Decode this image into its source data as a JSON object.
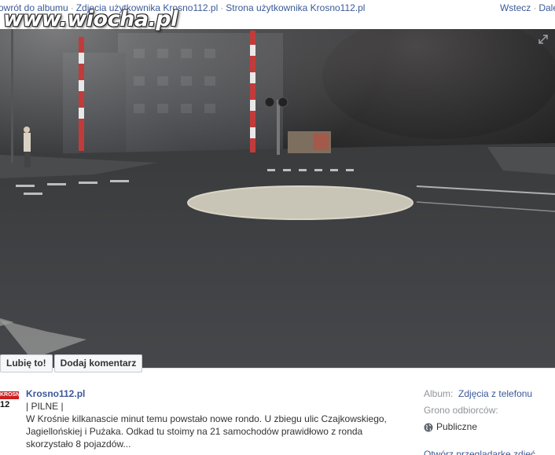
{
  "nav": {
    "back_to_album": "owrót do albumu",
    "user_photos": "Zdjęcia użytkownika Krosno112.pl",
    "user_page": "Strona użytkownika Krosno112.pl",
    "sep": "·",
    "prev": "Wstecz",
    "next": "Dale"
  },
  "watermark": "www.wiocha.pl",
  "photo_actions": {
    "like": "Lubię to!",
    "comment": "Dodaj komentarz"
  },
  "avatar": {
    "top": "KROSNO",
    "bottom": "12"
  },
  "post": {
    "author": "Krosno112.pl",
    "line1": "| PILNE |",
    "line2": "W Krośnie kilkanascie minut temu powstało nowe rondo. U zbiegu ulic Czajkowskiego,",
    "line3": "Jagiellońskiej i Pużaka. Odkad tu stoimy na 21 samochodów prawidłowo z ronda",
    "line4": "skorzystało 8 pojazdów..."
  },
  "side": {
    "album_label": "Album:",
    "album_link": "Zdjęcia z telefonu",
    "audience_label": "Grono odbiorców:",
    "audience_value": "Publiczne",
    "viewer_link": "Otwórz przeglądarkę zdjęć"
  },
  "colors": {
    "link": "#3b5998",
    "photo_bg": "#1b1b1d"
  }
}
